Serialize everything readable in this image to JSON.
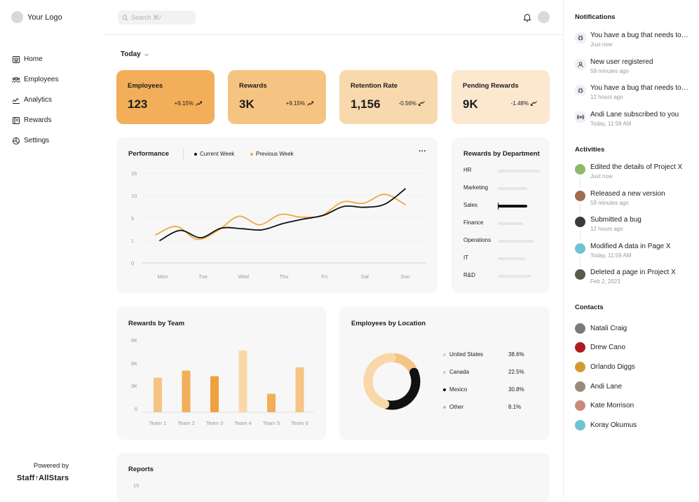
{
  "logo": {
    "text": "Your Logo"
  },
  "nav": [
    {
      "label": "Home",
      "icon": "home-icon"
    },
    {
      "label": "Employees",
      "icon": "users-icon"
    },
    {
      "label": "Analytics",
      "icon": "analytics-icon"
    },
    {
      "label": "Rewards",
      "icon": "rewards-icon"
    },
    {
      "label": "Settings",
      "icon": "settings-icon"
    }
  ],
  "footer": {
    "powered": "Powered by",
    "brand": "Staff↑AllStars"
  },
  "search": {
    "placeholder": "Search ⌘/"
  },
  "filter": {
    "label": "Today"
  },
  "colors": {
    "orange1": "#F2AE59",
    "orange2": "#F6C482",
    "orange3": "#F8D9AE",
    "orange4": "#FCE8CF",
    "black": "#111111",
    "orange_line": "#F0A93E"
  },
  "stats": [
    {
      "title": "Employees",
      "value": "123",
      "change": "+9.15%",
      "trend": "up"
    },
    {
      "title": "Rewards",
      "value": "3K",
      "change": "+9.15%",
      "trend": "up"
    },
    {
      "title": "Retention Rate",
      "value": "1,156",
      "change": "-0.56%",
      "trend": "down"
    },
    {
      "title": "Pending Rewards",
      "value": "9K",
      "change": "-1.48%",
      "trend": "down"
    }
  ],
  "performance": {
    "title": "Performance",
    "legend": [
      "Current Week",
      "Previous Week"
    ],
    "more": "···",
    "yticks": [
      "15",
      "10",
      "5",
      "1",
      "0"
    ],
    "xticks": [
      "Mon",
      "Tue",
      "Wed",
      "Thu",
      "Fri",
      "Sat",
      "Sun"
    ]
  },
  "rewards_dept": {
    "title": "Rewards by Department",
    "items": [
      {
        "label": "HR",
        "value": 0.75,
        "highlight": false
      },
      {
        "label": "Marketing",
        "value": 0.45,
        "highlight": false
      },
      {
        "label": "Sales",
        "value": 0.55,
        "highlight": true
      },
      {
        "label": "Finance",
        "value": 0.35,
        "highlight": false
      },
      {
        "label": "Operations",
        "value": 0.6,
        "highlight": false
      },
      {
        "label": "IT",
        "value": 0.4,
        "highlight": false
      },
      {
        "label": "R&D",
        "value": 0.55,
        "highlight": false
      }
    ]
  },
  "rewards_team": {
    "title": "Rewards by Team",
    "yticks": [
      "9K",
      "6K",
      "3K",
      "0"
    ]
  },
  "location": {
    "title": "Employees by Location",
    "items": [
      {
        "label": "United States",
        "value": "38.6%",
        "color": "#C6E4A8"
      },
      {
        "label": "Canada",
        "value": "22.5%",
        "color": "#C9C6F4"
      },
      {
        "label": "Mexico",
        "value": "30.8%",
        "color": "#111111"
      },
      {
        "label": "Other",
        "value": "8.1%",
        "color": "#A7B8F0"
      }
    ]
  },
  "reports": {
    "title": "Reports",
    "ytick": "15"
  },
  "chart_data": [
    {
      "type": "line",
      "title": "Performance",
      "categories": [
        "Mon",
        "Tue",
        "Wed",
        "Thu",
        "Fri",
        "Sat",
        "Sun"
      ],
      "ylim": [
        0,
        15
      ],
      "series": [
        {
          "name": "Current Week",
          "color": "#111111",
          "x": [
            0,
            0.5,
            1,
            1.5,
            2,
            2.5,
            3,
            3.5,
            4,
            4.5,
            5,
            5.5,
            6
          ],
          "values": [
            1,
            2.8,
            1.5,
            3.2,
            3.1,
            2.9,
            4.0,
            4.8,
            5.6,
            7.6,
            7.4,
            8.1,
            11.5
          ]
        },
        {
          "name": "Previous Week",
          "color": "#F0A93E",
          "x": [
            0,
            0.5,
            1,
            1.5,
            2,
            2.5,
            3,
            3.5,
            4,
            4.5,
            5,
            5.5,
            6
          ],
          "values": [
            2.0,
            3.5,
            1.2,
            2.8,
            5.4,
            3.8,
            5.8,
            5.2,
            5.6,
            8.6,
            8.3,
            10.3,
            8.0
          ]
        }
      ]
    },
    {
      "type": "bar",
      "title": "Rewards by Team",
      "categories": [
        "Team 1",
        "Team 2",
        "Team 3",
        "Team 4",
        "Team 5",
        "Team 6"
      ],
      "values": [
        4300,
        5200,
        4500,
        7700,
        2300,
        5600
      ],
      "colors": [
        "#F6C482",
        "#F2AE59",
        "#F0A13E",
        "#FAD7A8",
        "#F2AE59",
        "#F6C482"
      ],
      "ylim": [
        0,
        9000
      ]
    },
    {
      "type": "pie",
      "title": "Employees by Location",
      "categories": [
        "United States",
        "Canada",
        "Mexico",
        "Other"
      ],
      "values": [
        38.6,
        22.5,
        30.8,
        8.1
      ]
    }
  ],
  "right": {
    "notifications_title": "Notifications",
    "notifications": [
      {
        "icon": "bug-icon",
        "title": "You have a bug that needs to be fixed.",
        "time": "Just now"
      },
      {
        "icon": "user-icon",
        "title": "New user registered",
        "time": "59 minutes ago"
      },
      {
        "icon": "bug-icon",
        "title": "You have a bug that needs to be fixed.",
        "time": "12 hours ago"
      },
      {
        "icon": "broadcast-icon",
        "title": "Andi Lane subscribed to you",
        "time": "Today, 11:59 AM"
      }
    ],
    "activities_title": "Activities",
    "activities": [
      {
        "title": "Edited the details of Project X",
        "time": "Just now",
        "color": "#8fb86b"
      },
      {
        "title": "Released a new version",
        "time": "59 minutes ago",
        "color": "#a06b4f"
      },
      {
        "title": "Submitted a bug",
        "time": "12 hours ago",
        "color": "#3a3a3a"
      },
      {
        "title": "Modified A data in Page X",
        "time": "Today, 11:59 AM",
        "color": "#6fc3d6"
      },
      {
        "title": "Deleted a page in Project X",
        "time": "Feb 2, 2023",
        "color": "#5a5a4a"
      }
    ],
    "contacts_title": "Contacts",
    "contacts": [
      {
        "name": "Natali Craig",
        "color": "#7a7a7a"
      },
      {
        "name": "Drew Cano",
        "color": "#b01c1c"
      },
      {
        "name": "Orlando Diggs",
        "color": "#d39b2f"
      },
      {
        "name": "Andi Lane",
        "color": "#9b8a7a"
      },
      {
        "name": "Kate Morrison",
        "color": "#c98a7a"
      },
      {
        "name": "Koray Okumus",
        "color": "#6fc3d6"
      }
    ]
  }
}
